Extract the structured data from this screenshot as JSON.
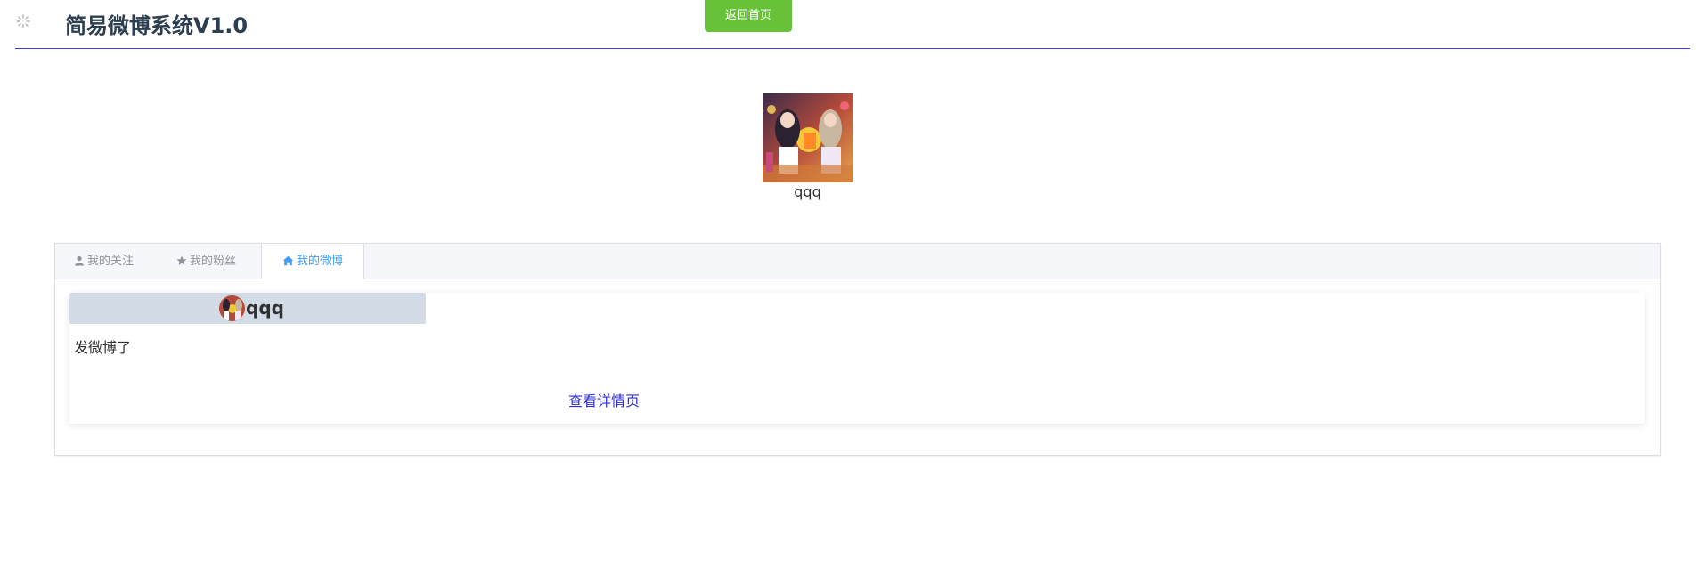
{
  "header": {
    "title": "简易微博系统V1.0",
    "home_button_label": "返回首页"
  },
  "profile": {
    "username": "qqq"
  },
  "tabs": [
    {
      "label": "我的关注",
      "icon": "user-icon"
    },
    {
      "label": "我的粉丝",
      "icon": "star-icon"
    },
    {
      "label": "我的微博",
      "icon": "home-icon",
      "active": true
    }
  ],
  "post": {
    "author": "qqq",
    "content": "发微博了",
    "detail_link_label": "查看详情页"
  },
  "colors": {
    "accent_green": "#67c23a",
    "active_tab": "#409eff",
    "link_blue": "#2f2fd8",
    "header_rule": "#3b3bd9",
    "author_bar": "#d3dce6"
  }
}
